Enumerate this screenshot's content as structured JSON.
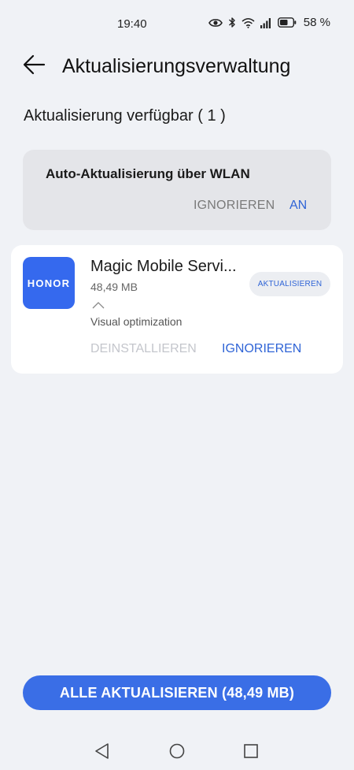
{
  "status_bar": {
    "time": "19:40",
    "battery_text": "58 %",
    "icons": [
      "eye-icon",
      "bluetooth-icon",
      "wifi-icon",
      "signal-icon",
      "battery-icon"
    ]
  },
  "header": {
    "back_icon": "arrow-left-icon",
    "title": "Aktualisierungsverwaltung"
  },
  "section": {
    "heading": "Aktualisierung verfügbar ( 1 )"
  },
  "wlan_card": {
    "title": "Auto-Aktualisierung über WLAN",
    "ignore_label": "IGNORIEREN",
    "on_label": "AN"
  },
  "app": {
    "icon_text": "HONOR",
    "name": "Magic Mobile Servi...",
    "size": "48,49 MB",
    "description": "Visual optimization",
    "update_label": "AKTUALISIEREN",
    "uninstall_label": "DEINSTALLIEREN",
    "ignore_label": "IGNORIEREN"
  },
  "footer": {
    "update_all_label": "ALLE AKTUALISIEREN (48,49 MB)"
  },
  "colors": {
    "background": "#f0f2f6",
    "accent": "#2f64d6",
    "primary_button": "#3a6ee6",
    "app_icon": "#3569ee"
  },
  "nav_bar": {
    "icons": [
      "nav-back-icon",
      "nav-home-icon",
      "nav-recents-icon"
    ]
  }
}
